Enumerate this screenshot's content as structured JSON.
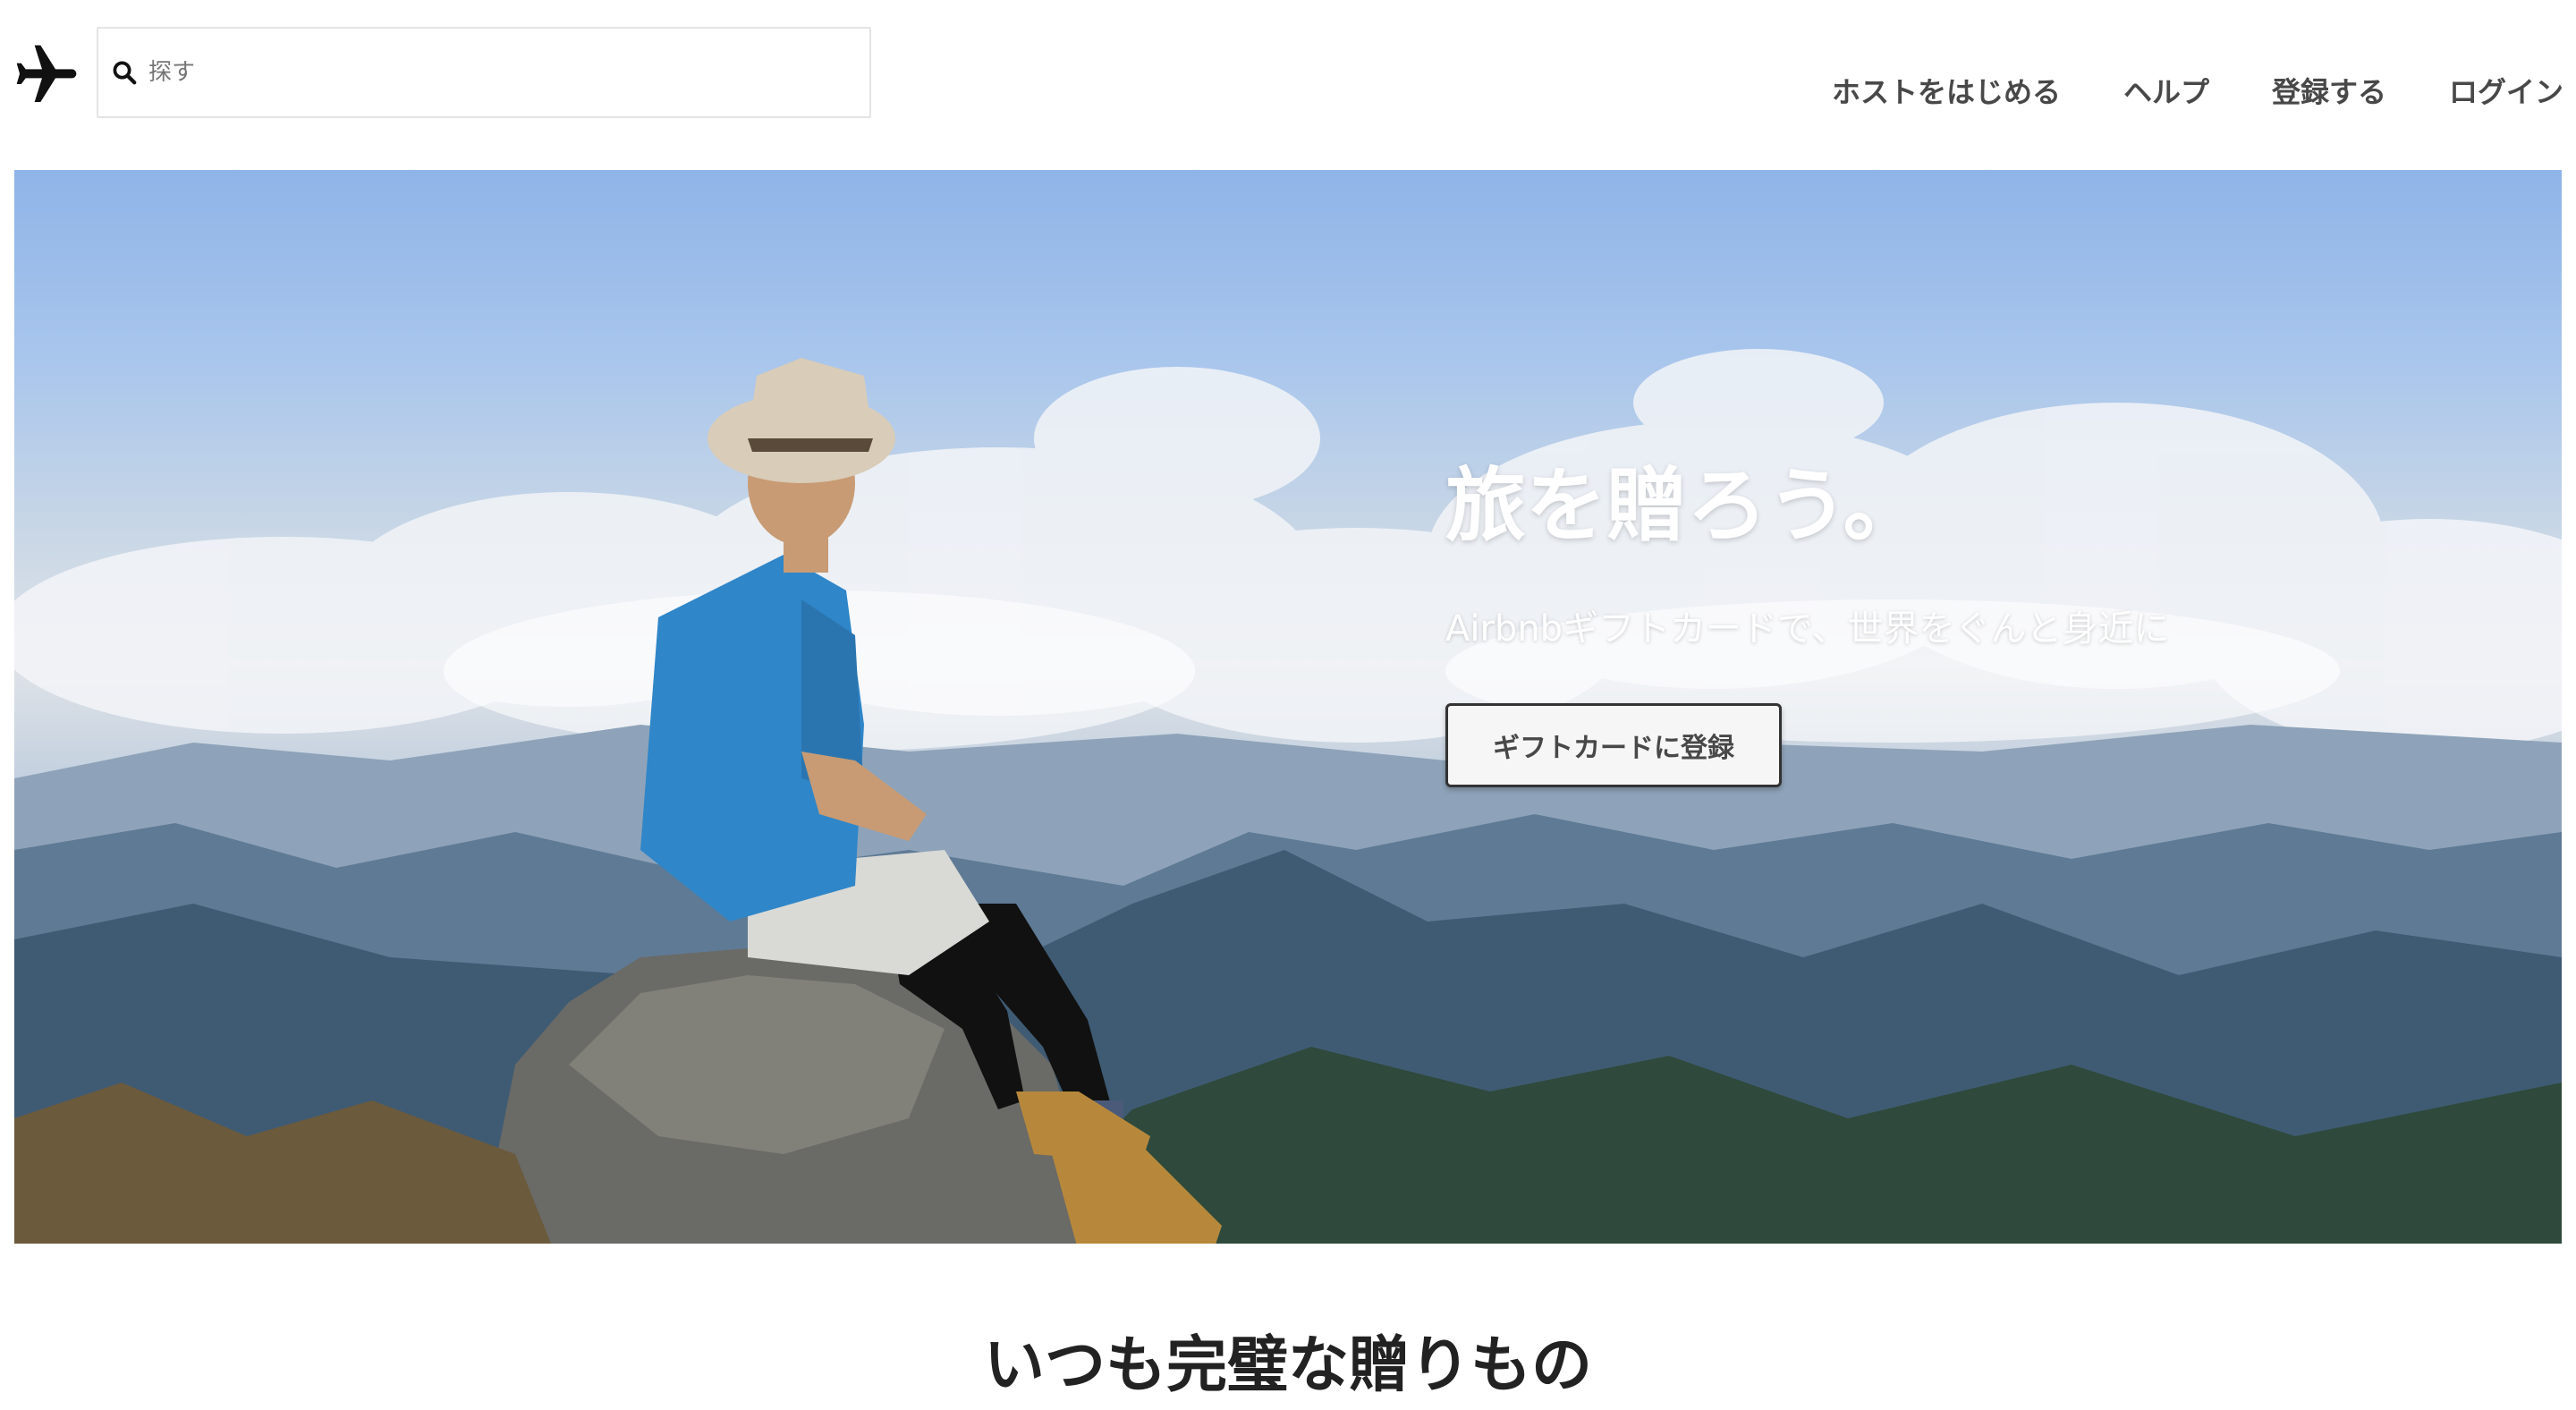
{
  "header": {
    "logo_icon": "airplane-icon",
    "search": {
      "placeholder": "探す",
      "value": "",
      "icon": "search-icon"
    },
    "nav": [
      {
        "label": "ホストをはじめる"
      },
      {
        "label": "ヘルプ"
      },
      {
        "label": "登録する"
      },
      {
        "label": "ログイン"
      }
    ]
  },
  "hero": {
    "title": "旅を贈ろう。",
    "subtitle": "Airbnbギフトカードで、世界をぐんと身近に",
    "button_label": "ギフトカードに登録"
  },
  "section": {
    "title": "いつも完璧な贈りもの"
  },
  "colors": {
    "text": "#222222",
    "nav_text": "#484848",
    "hero_text": "#ffffff",
    "button_bg": "#f6f6f6",
    "button_border": "#333333",
    "sky": "#8fb4e8",
    "mountain": "#4a6a86"
  }
}
